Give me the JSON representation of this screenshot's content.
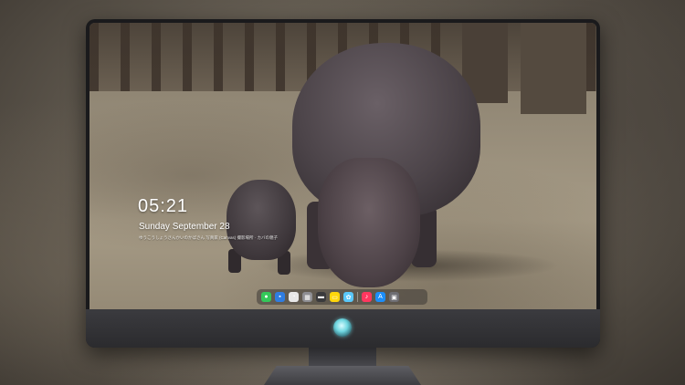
{
  "lock_screen": {
    "time": "05:21",
    "date": "Sunday September 28",
    "caption": "ゆうこうしょうさんかいのかばさん 写真家 (Canvas) 撮影場所 · カバの親子"
  },
  "dock": {
    "apps": [
      {
        "name": "messages-icon",
        "glyph": "●",
        "color": "#34c759"
      },
      {
        "name": "finder-icon",
        "glyph": "▪",
        "color": "#2f7de1"
      },
      {
        "name": "clock-icon",
        "glyph": "◔",
        "color": "#e8e8e8"
      },
      {
        "name": "launchpad-icon",
        "glyph": "▦",
        "color": "#8e8e93"
      },
      {
        "name": "clapper-icon",
        "glyph": "▬",
        "color": "#3a3a3c"
      },
      {
        "name": "notes-icon",
        "glyph": "▭",
        "color": "#ffd60a"
      },
      {
        "name": "photos-icon",
        "glyph": "✿",
        "color": "#5ac8fa"
      },
      {
        "name": "music-icon",
        "glyph": "♪",
        "color": "#ff375f"
      },
      {
        "name": "app-store-icon",
        "glyph": "A",
        "color": "#1c8ef9"
      },
      {
        "name": "trash-icon",
        "glyph": "▣",
        "color": "#6e6e73"
      }
    ]
  }
}
